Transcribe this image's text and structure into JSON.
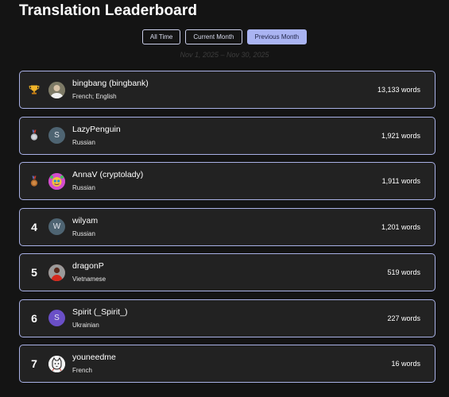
{
  "page": {
    "title": "Translation Leaderboard"
  },
  "tabs": [
    {
      "label": "All Time",
      "active": false
    },
    {
      "label": "Current Month",
      "active": false
    },
    {
      "label": "Previous Month",
      "active": true
    }
  ],
  "date_range": "Nov 1, 2025 – Nov 30, 2025",
  "entries": [
    {
      "rank": "1",
      "rank_icon": "trophy-icon",
      "avatar_icon": "user-photo-avatar",
      "name": "bingbang (bingbank)",
      "languages": "French; English",
      "words": "13,133 words"
    },
    {
      "rank": "2",
      "rank_icon": "silver-medal-icon",
      "avatar_letter": "S",
      "name": "LazyPenguin",
      "languages": "Russian",
      "words": "1,921 words"
    },
    {
      "rank": "3",
      "rank_icon": "bronze-medal-icon",
      "avatar_icon": "pink-cartoon-avatar",
      "name": "AnnaV (cryptolady)",
      "languages": "Russian",
      "words": "1,911 words"
    },
    {
      "rank": "4",
      "avatar_letter": "W",
      "name": "wilyam",
      "languages": "Russian",
      "words": "1,201 words"
    },
    {
      "rank": "5",
      "avatar_icon": "red-photo-avatar",
      "name": "dragonP",
      "languages": "Vietnamese",
      "words": "519 words"
    },
    {
      "rank": "6",
      "avatar_letter": "S",
      "name": "Spirit (_Spirit_)",
      "languages": "Ukrainian",
      "words": "227 words"
    },
    {
      "rank": "7",
      "avatar_icon": "cat-drawing-avatar",
      "name": "youneedme",
      "languages": "French",
      "words": "16 words"
    }
  ],
  "colors": {
    "background": "#141414",
    "row_background": "#222222",
    "row_border": "#a9b1e6",
    "active_tab": "#aab4f2",
    "avatar_slate": "#4e6472",
    "avatar_purple": "#6a4fc7"
  }
}
